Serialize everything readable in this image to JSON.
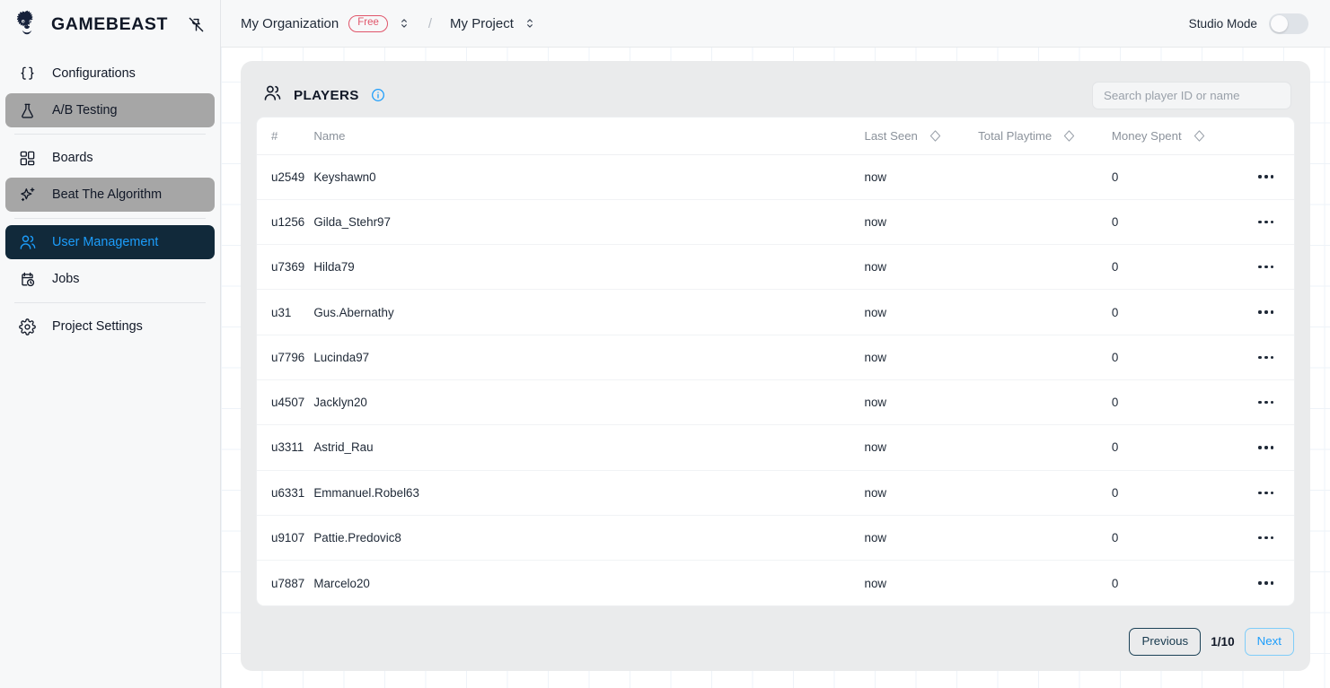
{
  "sidebar": {
    "brand_name": "GAMEBEAST",
    "logo_icon": "beast-head-logo",
    "pin_icon": "pin-off-icon",
    "items": [
      {
        "label": "Configurations",
        "icon": "braces-icon",
        "state": "default"
      },
      {
        "label": "A/B Testing",
        "icon": "flask-icon",
        "state": "hovered"
      },
      {
        "label": "Boards",
        "icon": "layout-grid-icon",
        "state": "default"
      },
      {
        "label": "Beat The Algorithm",
        "icon": "sparkles-icon",
        "state": "hovered"
      },
      {
        "label": "User Management",
        "icon": "users-icon",
        "state": "active"
      },
      {
        "label": "Jobs",
        "icon": "calendar-clock-icon",
        "state": "default"
      },
      {
        "label": "Project Settings",
        "icon": "gear-icon",
        "state": "default"
      }
    ]
  },
  "topbar": {
    "organization": "My Organization",
    "plan_badge": "Free",
    "separator": "/",
    "project": "My Project",
    "org_selector_icon": "chevron-up-down-icon",
    "project_selector_icon": "chevron-up-down-icon",
    "studio_mode_label": "Studio Mode",
    "studio_mode_on": false
  },
  "players_panel": {
    "title": "PLAYERS",
    "title_icon": "users-icon",
    "info_icon": "info-circle-icon",
    "search": {
      "placeholder": "Search player ID or name",
      "value": "",
      "icon": "search-icon"
    },
    "columns": [
      {
        "label": "#",
        "sortable": false
      },
      {
        "label": "Name",
        "sortable": false
      },
      {
        "label": "Last Seen",
        "sortable": true,
        "sort_icon": "diamond-sort-icon"
      },
      {
        "label": "Total Playtime",
        "sortable": true,
        "sort_icon": "diamond-sort-icon"
      },
      {
        "label": "Money Spent",
        "sortable": true,
        "sort_icon": "diamond-sort-icon"
      }
    ],
    "rows": [
      {
        "id": "u2549",
        "name": "Keyshawn0",
        "last_seen": "now",
        "total_playtime": "",
        "money_spent": "0"
      },
      {
        "id": "u1256",
        "name": "Gilda_Stehr97",
        "last_seen": "now",
        "total_playtime": "",
        "money_spent": "0"
      },
      {
        "id": "u7369",
        "name": "Hilda79",
        "last_seen": "now",
        "total_playtime": "",
        "money_spent": "0"
      },
      {
        "id": "u31",
        "name": "Gus.Abernathy",
        "last_seen": "now",
        "total_playtime": "",
        "money_spent": "0"
      },
      {
        "id": "u7796",
        "name": "Lucinda97",
        "last_seen": "now",
        "total_playtime": "",
        "money_spent": "0"
      },
      {
        "id": "u4507",
        "name": "Jacklyn20",
        "last_seen": "now",
        "total_playtime": "",
        "money_spent": "0"
      },
      {
        "id": "u3311",
        "name": "Astrid_Rau",
        "last_seen": "now",
        "total_playtime": "",
        "money_spent": "0"
      },
      {
        "id": "u6331",
        "name": "Emmanuel.Robel63",
        "last_seen": "now",
        "total_playtime": "",
        "money_spent": "0"
      },
      {
        "id": "u9107",
        "name": "Pattie.Predovic8",
        "last_seen": "now",
        "total_playtime": "",
        "money_spent": "0"
      },
      {
        "id": "u7887",
        "name": "Marcelo20",
        "last_seen": "now",
        "total_playtime": "",
        "money_spent": "0"
      }
    ],
    "row_menu_icon": "more-horizontal-icon",
    "pagination": {
      "previous_label": "Previous",
      "page_indicator": "1/10",
      "next_label": "Next"
    }
  },
  "colors": {
    "accent_blue": "#1c9dfb",
    "sidebar_active_bg": "#11293a",
    "sidebar_hover_bg": "#a6a6a6",
    "badge_free": "#e0556a",
    "card_bg": "#eaebec",
    "text_primary": "#1f2937",
    "text_muted": "#8b929b"
  }
}
